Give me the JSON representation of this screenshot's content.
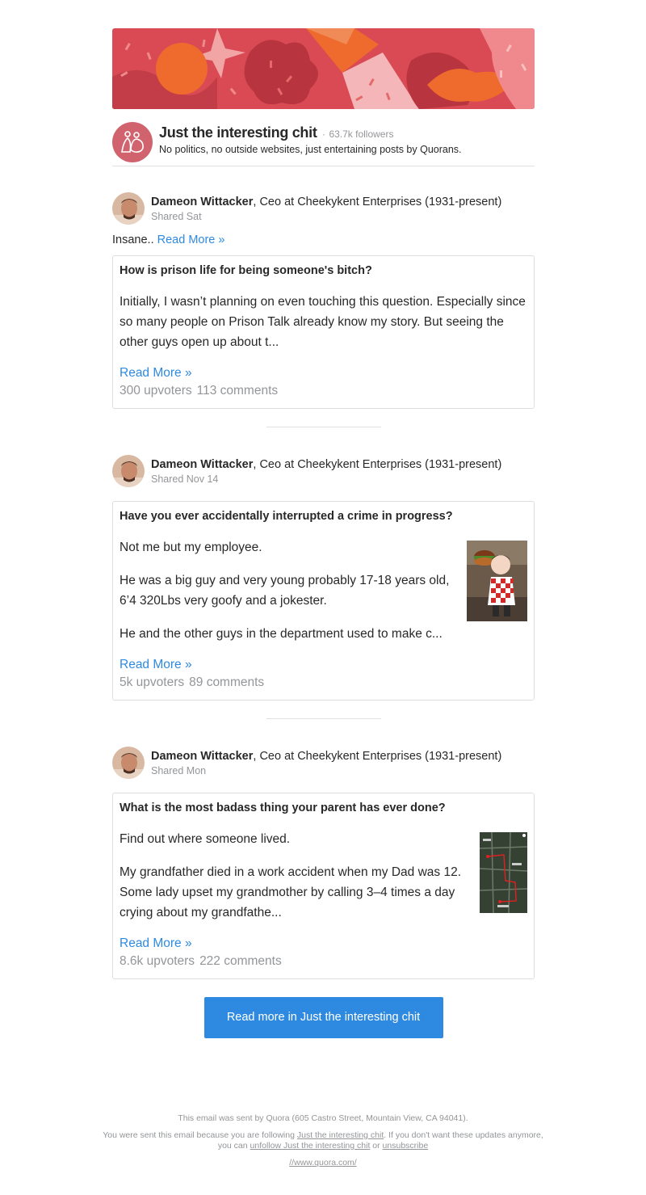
{
  "space": {
    "title": "Just the interesting chit",
    "dot": "·",
    "followers": "63.7k followers",
    "description": "No politics, no outside websites, just entertaining posts by Quorans."
  },
  "stories": [
    {
      "author_name": "Dameon Wittacker",
      "author_cred": ", Ceo at Cheekykent Enterprises (1931-present)",
      "shared": "Shared Sat",
      "comment": "Insane..",
      "comment_read_more": "Read More »",
      "question": "How is prison life for being someone's bitch?",
      "paragraphs": [
        "Initially, I wasn’t planning on even touching this question. Especially since so many people on Prison Talk already know my story. But seeing the other guys open up about t..."
      ],
      "read_more": "Read More »",
      "upvoters": "300 upvoters",
      "comments": "113 comments"
    },
    {
      "author_name": "Dameon Wittacker",
      "author_cred": ", Ceo at Cheekykent Enterprises (1931-present)",
      "shared": "Shared Nov 14",
      "question": "Have you ever accidentally interrupted a crime in progress?",
      "paragraphs": [
        "Not me but my employee.",
        "He was a big guy and very young probably 17-18 years old, 6’4 320Lbs very goofy and a jokester.",
        "He and the other guys in the department used to make c..."
      ],
      "read_more": "Read More »",
      "upvoters": "5k upvoters",
      "comments": "89 comments"
    },
    {
      "author_name": "Dameon Wittacker",
      "author_cred": ", Ceo at Cheekykent Enterprises (1931-present)",
      "shared": "Shared Mon",
      "question": "What is the most badass thing your parent has ever done?",
      "paragraphs": [
        "Find out where someone lived.",
        "My grandfather died in a work accident when my Dad was 12. Some lady upset my grandmother by calling 3–4 times a day crying about my grandfathe..."
      ],
      "read_more": "Read More »",
      "upvoters": "8.6k upvoters",
      "comments": "222 comments"
    }
  ],
  "cta": {
    "label": "Read more in Just the interesting chit"
  },
  "footer": {
    "line1": "This email was sent by Quora (605 Castro Street, Mountain View, CA 94041).",
    "line2_a": "You were sent this email because you are following ",
    "line2_link": "Just the interesting chit",
    "line2_b": ". If you don't want these updates anymore, you can ",
    "line2_unfollow": "unfollow Just the interesting chit",
    "line2_or": " or ",
    "line2_unsub": "unsubscribe",
    "url": "//www.quora.com/"
  },
  "colors": {
    "accent_blue": "#2e8ae0",
    "banner_red": "#d94a55",
    "space_logo": "#d1636f"
  }
}
